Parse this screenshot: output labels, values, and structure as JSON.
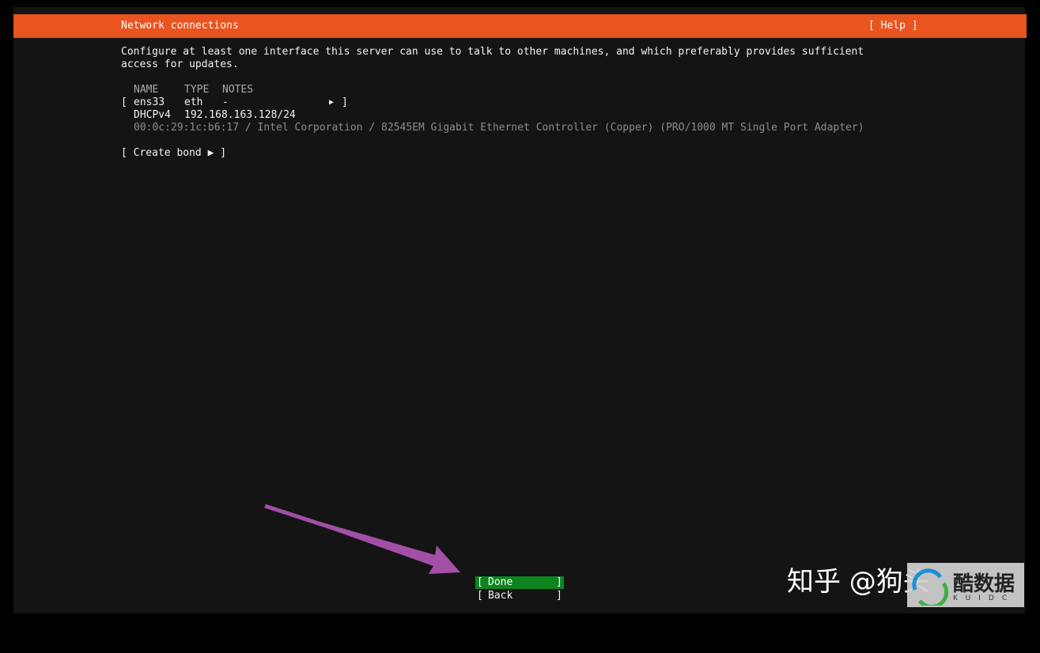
{
  "header": {
    "title": "Network connections",
    "help_label": "[ Help ]"
  },
  "intro": {
    "line1": "Configure at least one interface this server can use to talk to other machines, and which preferably provides sufficient",
    "line2": "access for updates."
  },
  "table": {
    "columns": [
      "NAME",
      "TYPE",
      "NOTES"
    ],
    "interface": {
      "name": "ens33",
      "type": "eth",
      "notes": "-",
      "dhcp_label": "DHCPv4",
      "ip": "192.168.163.128/24",
      "details": "00:0c:29:1c:b6:17 / Intel Corporation / 82545EM Gigabit Ethernet Controller (Copper) (PRO/1000 MT Single Port Adapter)"
    }
  },
  "bond": {
    "label": "Create bond ▶"
  },
  "buttons": {
    "done": "Done",
    "back": "Back"
  },
  "watermark": {
    "text": "知乎 @狗头",
    "logo_text": "酷数据",
    "logo_sub": "KUIDC"
  },
  "colors": {
    "header": "#e95420",
    "selected": "#0e8420",
    "background": "#141414",
    "arrow": "#a24fa8"
  }
}
